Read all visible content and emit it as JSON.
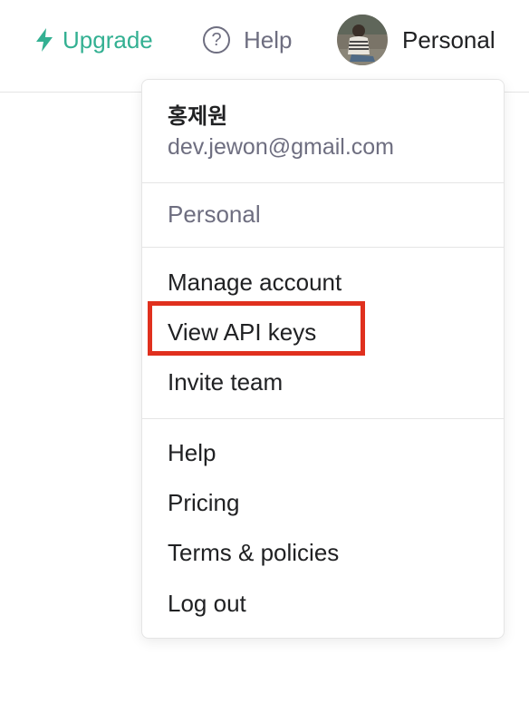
{
  "header": {
    "upgrade_label": "Upgrade",
    "help_label": "Help",
    "account_label": "Personal"
  },
  "menu": {
    "user_name": "홍제원",
    "user_email": "dev.jewon@gmail.com",
    "org_label": "Personal",
    "account_items": [
      "Manage account",
      "View API keys",
      "Invite team"
    ],
    "footer_items": [
      "Help",
      "Pricing",
      "Terms & policies",
      "Log out"
    ]
  },
  "colors": {
    "accent": "#10a37f",
    "highlight": "#e0301e",
    "muted_text": "#6e6e80",
    "text": "#202123"
  },
  "icons": {
    "upgrade": "lightning-bolt-icon",
    "help": "question-circle-icon"
  }
}
